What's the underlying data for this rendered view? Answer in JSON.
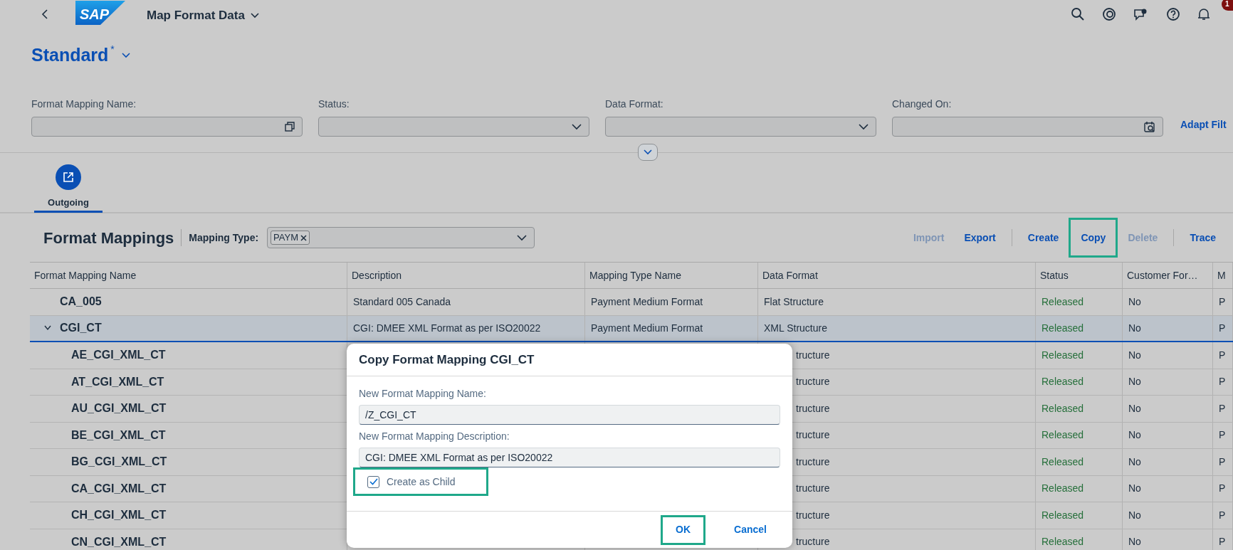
{
  "shell": {
    "logo": "SAP",
    "title": "Map Format Data",
    "notification_count": "1"
  },
  "variant": {
    "name": "Standard",
    "modified_mark": "*"
  },
  "filters": [
    {
      "label": "Format Mapping Name:",
      "kind": "valuehelp"
    },
    {
      "label": "Status:",
      "kind": "select"
    },
    {
      "label": "Data Format:",
      "kind": "select"
    },
    {
      "label": "Changed On:",
      "kind": "date"
    }
  ],
  "adapt_filters": "Adapt Filt",
  "tabs": [
    {
      "label": "Outgoing",
      "selected": true
    }
  ],
  "table": {
    "title": "Format Mappings",
    "mapping_type_label": "Mapping Type:",
    "mapping_type_tokens": [
      "PAYM"
    ],
    "actions": [
      {
        "label": "Import",
        "disabled": true,
        "highlighted": false
      },
      {
        "label": "Export",
        "disabled": false,
        "highlighted": false
      },
      {
        "label": "Create",
        "disabled": false,
        "highlighted": false
      },
      {
        "label": "Copy",
        "disabled": false,
        "highlighted": true
      },
      {
        "label": "Delete",
        "disabled": true,
        "highlighted": false
      },
      {
        "label": "Trace",
        "disabled": false,
        "highlighted": false
      }
    ],
    "columns": [
      "Format Mapping Name",
      "Description",
      "Mapping Type Name",
      "Data Format",
      "Status",
      "Customer For…",
      "M"
    ],
    "rows": [
      {
        "name": "CA_005",
        "description": "Standard 005 Canada",
        "mapping_type": "Payment Medium Format",
        "data_format": "Flat Structure",
        "status": "Released",
        "customer_format": "No",
        "column_7": "P",
        "selected": false
      },
      {
        "name": "CGI_CT",
        "description": "CGI: DMEE XML Format as per ISO20022",
        "mapping_type": "Payment Medium Format",
        "data_format": "XML Structure",
        "status": "Released",
        "customer_format": "No",
        "column_7": "P",
        "selected": true,
        "expanded": true,
        "children": [
          {
            "name": "AE_CGI_XML_CT",
            "data_format": "tructure",
            "status": "Released",
            "customer_format": "No",
            "column_7": "P",
            "selected": false
          },
          {
            "name": "AT_CGI_XML_CT",
            "data_format": "tructure",
            "status": "Released",
            "customer_format": "No",
            "column_7": "P",
            "selected": false
          },
          {
            "name": "AU_CGI_XML_CT",
            "data_format": "tructure",
            "status": "Released",
            "customer_format": "No",
            "column_7": "P",
            "selected": false
          },
          {
            "name": "BE_CGI_XML_CT",
            "data_format": "tructure",
            "status": "Released",
            "customer_format": "No",
            "column_7": "P",
            "selected": false
          },
          {
            "name": "BG_CGI_XML_CT",
            "data_format": "tructure",
            "status": "Released",
            "customer_format": "No",
            "column_7": "P",
            "selected": false
          },
          {
            "name": "CA_CGI_XML_CT",
            "data_format": "tructure",
            "status": "Released",
            "customer_format": "No",
            "column_7": "P",
            "selected": false
          },
          {
            "name": "CH_CGI_XML_CT",
            "data_format": "tructure",
            "status": "Released",
            "customer_format": "No",
            "column_7": "P",
            "selected": false
          },
          {
            "name": "CN_CGI_XML_CT",
            "data_format": "tructure",
            "status": "Released",
            "customer_format": "No",
            "column_7": "P",
            "selected": false
          }
        ]
      }
    ]
  },
  "dialog": {
    "title": "Copy Format Mapping CGI_CT",
    "fields": [
      {
        "label": "New Format Mapping Name:",
        "value": "/Z_CGI_CT"
      },
      {
        "label": "New Format Mapping Description:",
        "value": "CGI: DMEE XML Format as per ISO20022"
      }
    ],
    "checkbox": {
      "label": "Create as Child",
      "checked": true,
      "highlighted": true
    },
    "buttons": [
      {
        "label": "OK",
        "highlighted": true
      },
      {
        "label": "Cancel",
        "highlighted": false
      }
    ]
  }
}
